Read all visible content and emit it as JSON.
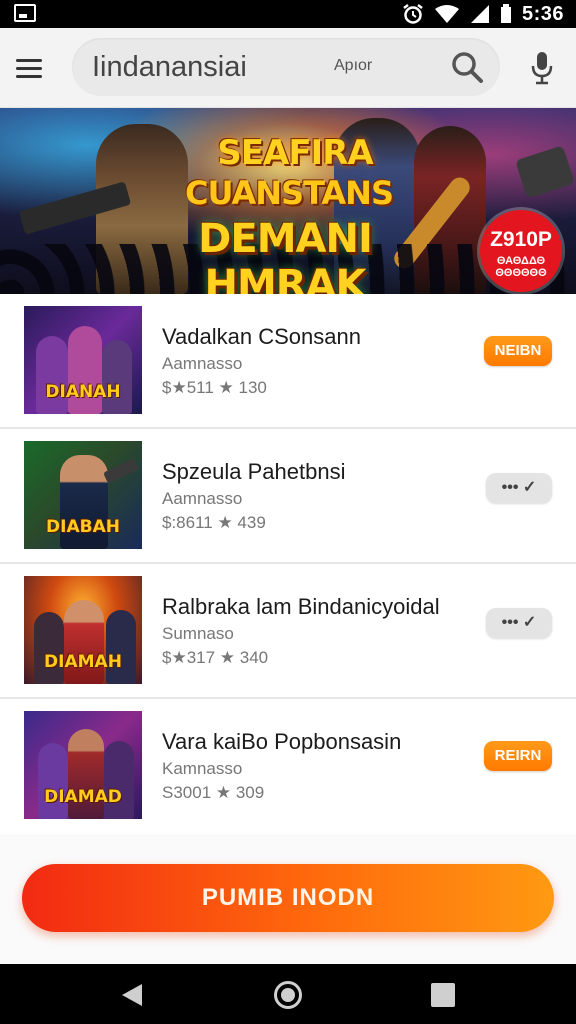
{
  "status_bar": {
    "time": "5:36",
    "icons": [
      "screenshot-icon",
      "alarm-icon",
      "wifi-icon",
      "signal-icon",
      "battery-icon"
    ]
  },
  "app_bar": {
    "search_value": "Iindanansiai",
    "search_chip": "Apıor",
    "icons": [
      "menu-icon",
      "search-icon",
      "mic-icon"
    ]
  },
  "banner": {
    "title_top": "SEAFIRA",
    "title_mid": "CUANSTANS",
    "title_main": "DEMANI HMRAK",
    "badge_price": "Z910P",
    "badge_text": "ΘΑΘΔΔΘ ΘΘΘΘΘΘ"
  },
  "apps": [
    {
      "thumb_caption": "DIANAH",
      "title": "Vadalkan CSonsann",
      "subtitle": "Aamnasso",
      "meta": "$★511 ★ 130",
      "action_type": "install",
      "action_label": "NEIBN"
    },
    {
      "thumb_caption": "DIABAH",
      "title": "Spzeula Pahetbnsi",
      "subtitle": "Aamnasso",
      "meta": "$:8611 ★ 439",
      "action_type": "more",
      "action_label": "••• ✓"
    },
    {
      "thumb_caption": "DIAMAH",
      "title": "Ralbraka lam Bindanicyoidal",
      "subtitle": "Sumnaso",
      "meta": "$★317 ★ 340",
      "action_type": "more",
      "action_label": "••• ✓"
    },
    {
      "thumb_caption": "DIAMAD",
      "title": "Vara kaiBo Popbonsasin",
      "subtitle": "Kamnasso",
      "meta": "S3001 ★ 309",
      "action_type": "install",
      "action_label": "REIRN"
    }
  ],
  "cta": {
    "label": "PUMIB INODN"
  },
  "colors": {
    "accent_orange": "#ff8a00",
    "cta_start": "#f22a12",
    "cta_end": "#ff9a12",
    "status_bar": "#000000",
    "badge_red": "#e3161f"
  }
}
